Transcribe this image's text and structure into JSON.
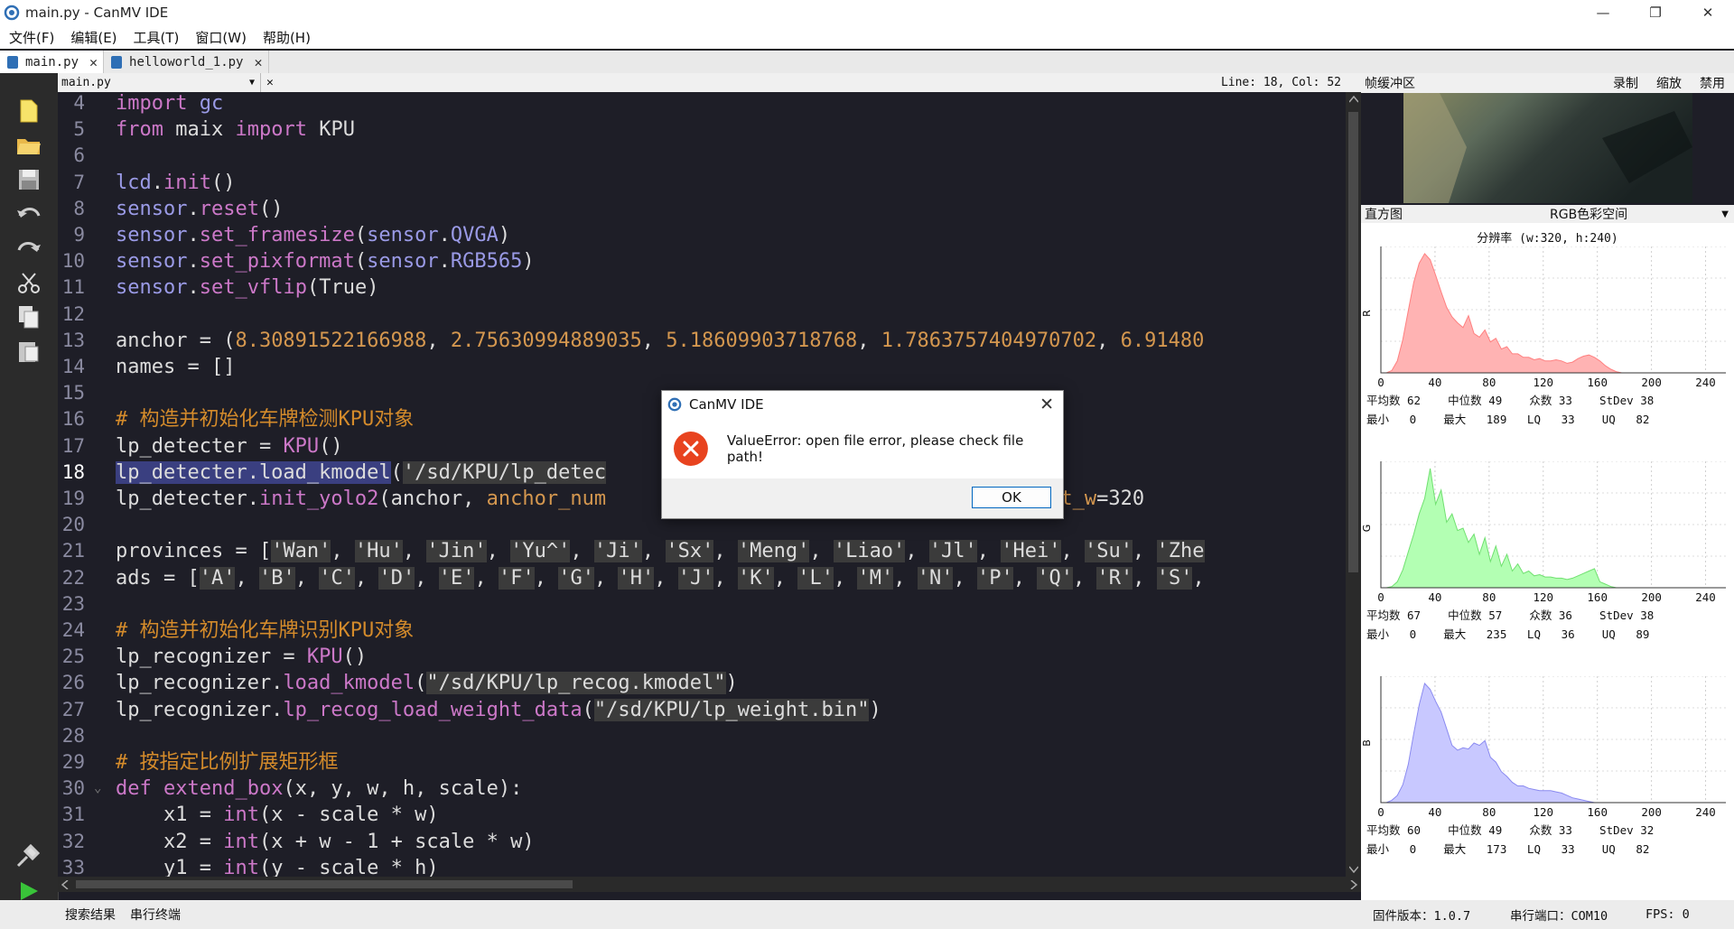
{
  "window": {
    "title": "main.py - CanMV IDE",
    "controls": [
      "—",
      "❐",
      "✕"
    ]
  },
  "menu": [
    "文件(F)",
    "编辑(E)",
    "工具(T)",
    "窗口(W)",
    "帮助(H)"
  ],
  "tabs": [
    {
      "label": "main.py",
      "active": true
    },
    {
      "label": "helloworld_1.py",
      "active": false
    }
  ],
  "filebar": {
    "file": "main.py",
    "close": "✕",
    "position": "Line: 18, Col: 52"
  },
  "editor": {
    "lines": [
      {
        "n": "4",
        "html": "<span style='color:#cc78c8'>import</span> <span style='color:#9a9ae6'>gc</span>"
      },
      {
        "n": "5",
        "html": "<span style='color:#cc78c8'>from</span> <span style='color:#dcdcdc'>maix</span> <span style='color:#cc78c8'>import</span> <span style='color:#dcdcdc'>KPU</span>"
      },
      {
        "n": "6",
        "html": ""
      },
      {
        "n": "7",
        "html": "<span style='color:#9a9ae6'>lcd</span>.<span style='color:#cc78c8'>init</span>()"
      },
      {
        "n": "8",
        "html": "<span style='color:#9a9ae6'>sensor</span>.<span style='color:#cc78c8'>reset</span>()"
      },
      {
        "n": "9",
        "html": "<span style='color:#9a9ae6'>sensor</span>.<span style='color:#cc78c8'>set_framesize</span>(<span style='color:#9a9ae6'>sensor</span>.<span style='color:#9a9ae6'>QVGA</span>)"
      },
      {
        "n": "10",
        "html": "<span style='color:#9a9ae6'>sensor</span>.<span style='color:#cc78c8'>set_pixformat</span>(<span style='color:#9a9ae6'>sensor</span>.<span style='color:#9a9ae6'>RGB565</span>)"
      },
      {
        "n": "11",
        "html": "<span style='color:#9a9ae6'>sensor</span>.<span style='color:#cc78c8'>set_vflip</span>(<span style='color:#dcdcdc'>True</span>)"
      },
      {
        "n": "12",
        "html": ""
      },
      {
        "n": "13",
        "html": "anchor = (<span style='color:#d4974f'>8.30891522166988</span>, <span style='color:#d4974f'>2.75630994889035</span>, <span style='color:#d4974f'>5.18609903718768</span>, <span style='color:#d4974f'>1.7863757404970702</span>, <span style='color:#d4974f'>6.91480</span>"
      },
      {
        "n": "14",
        "html": "names = []"
      },
      {
        "n": "15",
        "html": ""
      },
      {
        "n": "16",
        "html": "<span style='color:#d48b2b'># 构造并初始化车牌检测KPU对象</span>"
      },
      {
        "n": "17",
        "html": "lp_detecter = <span style='color:#cc78c8'>KPU</span>()"
      },
      {
        "n": "18",
        "html": "<span style='background:#3a3f80'>lp_detecter.load_kmodel</span>(<span style='background:#3b3b3b;color:#dcdcdc'>'/sd/KPU/lp_detec</span>"
      },
      {
        "n": "19",
        "html": "lp_detecter.<span style='color:#cc78c8'>init_yolo2</span>(anchor, <span style='color:#d4974f'>anchor_num</span>                         <span style='color:#d4974f'>img_h</span>=240, <span style='color:#d4974f'>net_w</span>=320"
      },
      {
        "n": "20",
        "html": ""
      },
      {
        "n": "21",
        "html": "provinces = [<span style='background:#3b3b3b'>'Wan'</span>, <span style='background:#3b3b3b'>'Hu'</span>, <span style='background:#3b3b3b'>'Jin'</span>, <span style='background:#3b3b3b'>'Yu^'</span>, <span style='background:#3b3b3b'>'Ji'</span>, <span style='background:#3b3b3b'>'Sx'</span>, <span style='background:#3b3b3b'>'Meng'</span>, <span style='background:#3b3b3b'>'Liao'</span>, <span style='background:#3b3b3b'>'Jl'</span>, <span style='background:#3b3b3b'>'Hei'</span>, <span style='background:#3b3b3b'>'Su'</span>, <span style='background:#3b3b3b'>'Zhe</span>"
      },
      {
        "n": "22",
        "html": "ads = [<span style='background:#3b3b3b'>'A'</span>, <span style='background:#3b3b3b'>'B'</span>, <span style='background:#3b3b3b'>'C'</span>, <span style='background:#3b3b3b'>'D'</span>, <span style='background:#3b3b3b'>'E'</span>, <span style='background:#3b3b3b'>'F'</span>, <span style='background:#3b3b3b'>'G'</span>, <span style='background:#3b3b3b'>'H'</span>, <span style='background:#3b3b3b'>'J'</span>, <span style='background:#3b3b3b'>'K'</span>, <span style='background:#3b3b3b'>'L'</span>, <span style='background:#3b3b3b'>'M'</span>, <span style='background:#3b3b3b'>'N'</span>, <span style='background:#3b3b3b'>'P'</span>, <span style='background:#3b3b3b'>'Q'</span>, <span style='background:#3b3b3b'>'R'</span>, <span style='background:#3b3b3b'>'S'</span>,"
      },
      {
        "n": "23",
        "html": ""
      },
      {
        "n": "24",
        "html": "<span style='color:#d48b2b'># 构造并初始化车牌识别KPU对象</span>"
      },
      {
        "n": "25",
        "html": "lp_recognizer = <span style='color:#cc78c8'>KPU</span>()"
      },
      {
        "n": "26",
        "html": "lp_recognizer.<span style='color:#cc78c8'>load_kmodel</span>(<span style='background:#3b3b3b'>\"/sd/KPU/lp_recog.kmodel\"</span>)"
      },
      {
        "n": "27",
        "html": "lp_recognizer.<span style='color:#cc78c8'>lp_recog_load_weight_data</span>(<span style='background:#3b3b3b'>\"/sd/KPU/lp_weight.bin\"</span>)"
      },
      {
        "n": "28",
        "html": ""
      },
      {
        "n": "29",
        "html": "<span style='color:#d48b2b'># 按指定比例扩展矩形框</span>"
      },
      {
        "n": "30",
        "html": "<span style='color:#cc78c8'>def</span> <span style='color:#cc78c8'>extend_box</span>(x, y, w, h, scale):"
      },
      {
        "n": "31",
        "html": "    x1 = <span style='color:#cc78c8'>int</span>(x - scale * w)"
      },
      {
        "n": "32",
        "html": "    x2 = <span style='color:#cc78c8'>int</span>(x + w - 1 + scale * w)"
      },
      {
        "n": "33",
        "html": "    y1 = <span style='color:#cc78c8'>int</span>(y - scale * h)"
      }
    ],
    "current_line": "18"
  },
  "framebuffer": {
    "title": "帧缓冲区",
    "buttons": [
      "录制",
      "缩放",
      "禁用"
    ]
  },
  "histogram": {
    "title": "直方图",
    "colorspace": "RGB色彩空间",
    "resolution": "分辨率 (w:320, h:240)",
    "ticks": [
      "0",
      "40",
      "80",
      "120",
      "160",
      "200",
      "240"
    ],
    "channels": [
      {
        "label": "R",
        "color": "#ffb3b3",
        "stroke": "#ff8080",
        "stats1": "平均数 62    中位数 49    众数 33    StDev 38",
        "stats2": "最小   0    最大   189   LQ   33    UQ   82",
        "profile": [
          0,
          0,
          0.02,
          0.1,
          0.28,
          0.52,
          0.76,
          0.92,
          1.0,
          0.95,
          0.82,
          0.68,
          0.55,
          0.47,
          0.42,
          0.38,
          0.48,
          0.33,
          0.3,
          0.36,
          0.26,
          0.29,
          0.2,
          0.22,
          0.16,
          0.16,
          0.13,
          0.13,
          0.11,
          0.12,
          0.1,
          0.1,
          0.11,
          0.1,
          0.08,
          0.09,
          0.12,
          0.14,
          0.15,
          0.13,
          0.1,
          0.06,
          0.03,
          0.01,
          0,
          0,
          0,
          0,
          0,
          0,
          0,
          0,
          0,
          0,
          0,
          0,
          0,
          0,
          0,
          0,
          0,
          0,
          0,
          0
        ]
      },
      {
        "label": "G",
        "color": "#b3ffb3",
        "stroke": "#70e070",
        "stats1": "平均数 67    中位数 57    众数 36    StDev 38",
        "stats2": "最小   0    最大   235   LQ   36    UQ   89",
        "profile": [
          0,
          0,
          0.01,
          0.05,
          0.15,
          0.3,
          0.45,
          0.62,
          0.75,
          1.0,
          0.7,
          0.82,
          0.55,
          0.62,
          0.48,
          0.5,
          0.38,
          0.45,
          0.28,
          0.42,
          0.22,
          0.35,
          0.18,
          0.28,
          0.14,
          0.2,
          0.12,
          0.14,
          0.1,
          0.11,
          0.09,
          0.09,
          0.08,
          0.08,
          0.07,
          0.08,
          0.1,
          0.12,
          0.14,
          0.16,
          0.05,
          0.03,
          0.01,
          0,
          0,
          0,
          0,
          0,
          0,
          0,
          0,
          0,
          0,
          0,
          0,
          0,
          0,
          0,
          0,
          0,
          0,
          0,
          0,
          0
        ]
      },
      {
        "label": "B",
        "color": "#c8c8ff",
        "stroke": "#8a8af0",
        "stats1": "平均数 60    中位数 49    众数 33    StDev 32",
        "stats2": "最小   0    最大   173   LQ   33    UQ   82",
        "profile": [
          0,
          0,
          0.02,
          0.06,
          0.15,
          0.32,
          0.58,
          0.82,
          1.0,
          0.95,
          0.85,
          0.76,
          0.62,
          0.48,
          0.44,
          0.46,
          0.45,
          0.5,
          0.48,
          0.52,
          0.38,
          0.34,
          0.26,
          0.22,
          0.17,
          0.14,
          0.14,
          0.12,
          0.11,
          0.1,
          0.1,
          0.1,
          0.09,
          0.08,
          0.06,
          0.04,
          0.03,
          0.02,
          0.01,
          0,
          0,
          0,
          0,
          0,
          0,
          0,
          0,
          0,
          0,
          0,
          0,
          0,
          0,
          0,
          0,
          0,
          0,
          0,
          0,
          0,
          0,
          0,
          0,
          0
        ]
      }
    ]
  },
  "status": {
    "search": "搜索结果",
    "serial": "串行终端",
    "firmware": "固件版本：1.0.7",
    "port": "串行端口：COM10",
    "fps": "FPS: 0"
  },
  "dialog": {
    "title": "CanMV IDE",
    "message": "ValueError: open file error, please check file path!",
    "ok": "OK",
    "close": "✕"
  }
}
